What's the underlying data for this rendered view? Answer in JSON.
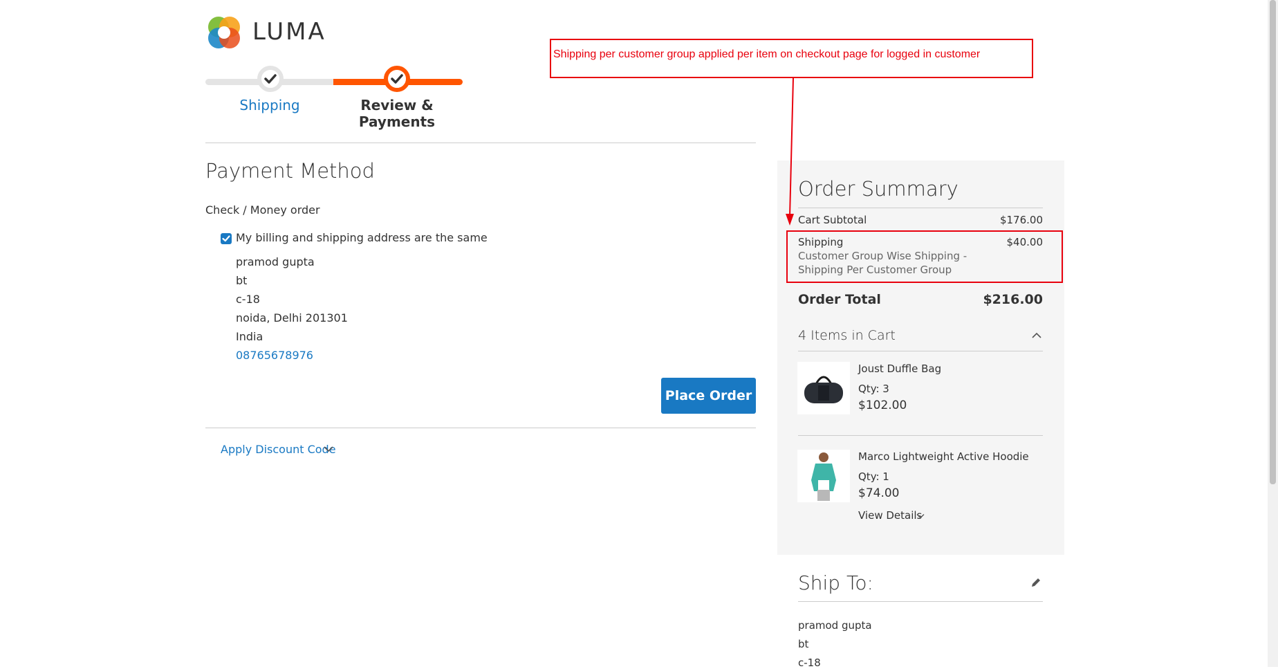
{
  "brand": {
    "name": "LUMA"
  },
  "progress": {
    "steps": [
      {
        "label": "Shipping",
        "state": "complete"
      },
      {
        "label": "Review & Payments",
        "state": "active"
      }
    ]
  },
  "payment": {
    "title": "Payment Method",
    "method_label": "Check / Money order",
    "same_address_label": "My billing and shipping address are the same",
    "same_address_checked": true,
    "billing_address": [
      "pramod gupta",
      "bt",
      "c-18",
      "noida, Delhi 201301",
      "India"
    ],
    "phone": "08765678976",
    "place_order_label": "Place Order",
    "discount_label": "Apply Discount Code"
  },
  "summary": {
    "title": "Order Summary",
    "subtotal_label": "Cart Subtotal",
    "subtotal_value": "$176.00",
    "shipping_label": "Shipping",
    "shipping_value": "$40.00",
    "shipping_method": "Customer Group Wise Shipping - Shipping Per Customer Group",
    "total_label": "Order Total",
    "total_value": "$216.00",
    "items_count_label": "4 Items in Cart",
    "items": [
      {
        "name": "Joust Duffle Bag",
        "qty": "Qty: 3",
        "price": "$102.00"
      },
      {
        "name": "Marco Lightweight Active Hoodie",
        "qty": "Qty: 1",
        "price": "$74.00",
        "details_label": "View Details"
      }
    ]
  },
  "ship_to": {
    "title": "Ship To:",
    "address": [
      "pramod gupta",
      "bt",
      "c-18"
    ]
  },
  "annotation": {
    "text": "Shipping per customer group applied per item on checkout page for logged in customer",
    "color": "#e8000d"
  },
  "colors": {
    "accent": "#1979c3",
    "progress": "#ff5501",
    "panel": "#f5f5f5"
  }
}
